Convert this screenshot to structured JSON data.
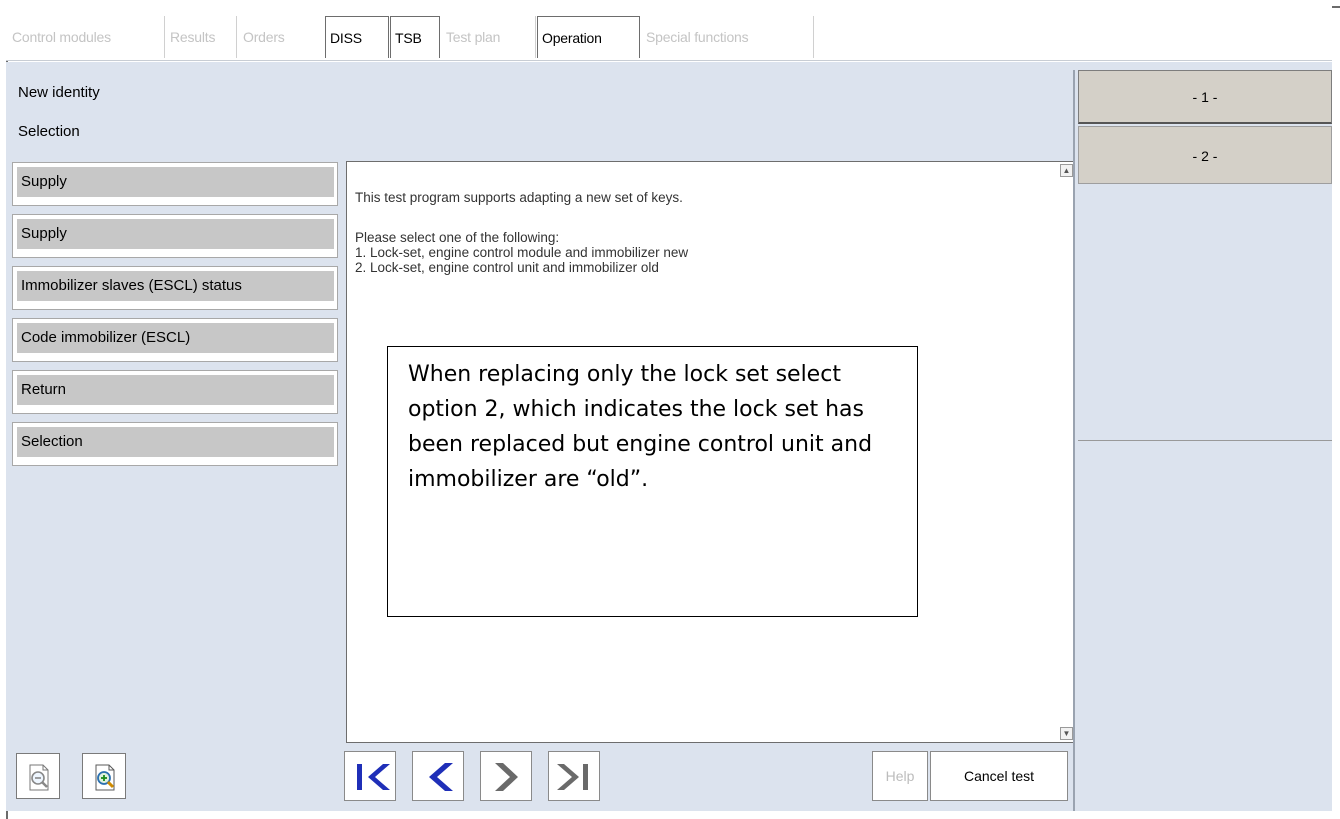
{
  "tabs": [
    {
      "label": "Control modules",
      "active": false
    },
    {
      "label": "Results",
      "active": false
    },
    {
      "label": "Orders",
      "active": false
    },
    {
      "label": "DISS",
      "active": true
    },
    {
      "label": "TSB",
      "active": true
    },
    {
      "label": "Test plan",
      "active": false
    },
    {
      "label": "Operation",
      "active": true
    },
    {
      "label": "Special functions",
      "active": false
    }
  ],
  "header": {
    "line1": "New identity",
    "line2": "Selection"
  },
  "sidebar": {
    "items": [
      {
        "label": "Supply"
      },
      {
        "label": "Supply"
      },
      {
        "label": "Immobilizer slaves (ESCL) status"
      },
      {
        "label": "Code immobilizer (ESCL)"
      },
      {
        "label": "Return"
      },
      {
        "label": "Selection"
      }
    ]
  },
  "content": {
    "intro": "This test program supports adapting a new set of keys.",
    "prompt": "Please select one of the following:",
    "option1": "1. Lock-set, engine control module and immobilizer new",
    "option2": "2. Lock-set, engine control unit and immobilizer old"
  },
  "note": {
    "text": "When replacing only the lock set select option 2, which indicates the lock set has been replaced but engine control unit and immobilizer are “old”."
  },
  "right_panel": {
    "button1": "- 1 -",
    "button2": "- 2 -"
  },
  "bottom": {
    "help_label": "Help",
    "cancel_label": "Cancel test"
  },
  "colors": {
    "panel_bg": "#dce3ee",
    "nav_blue": "#1f2fb8",
    "nav_gray": "#6a6a6a"
  },
  "icons": {
    "zoom_out": "zoom-out-icon",
    "zoom_in": "zoom-in-icon",
    "first": "first-page-icon",
    "back": "back-icon",
    "forward": "forward-icon",
    "last": "last-page-icon"
  }
}
